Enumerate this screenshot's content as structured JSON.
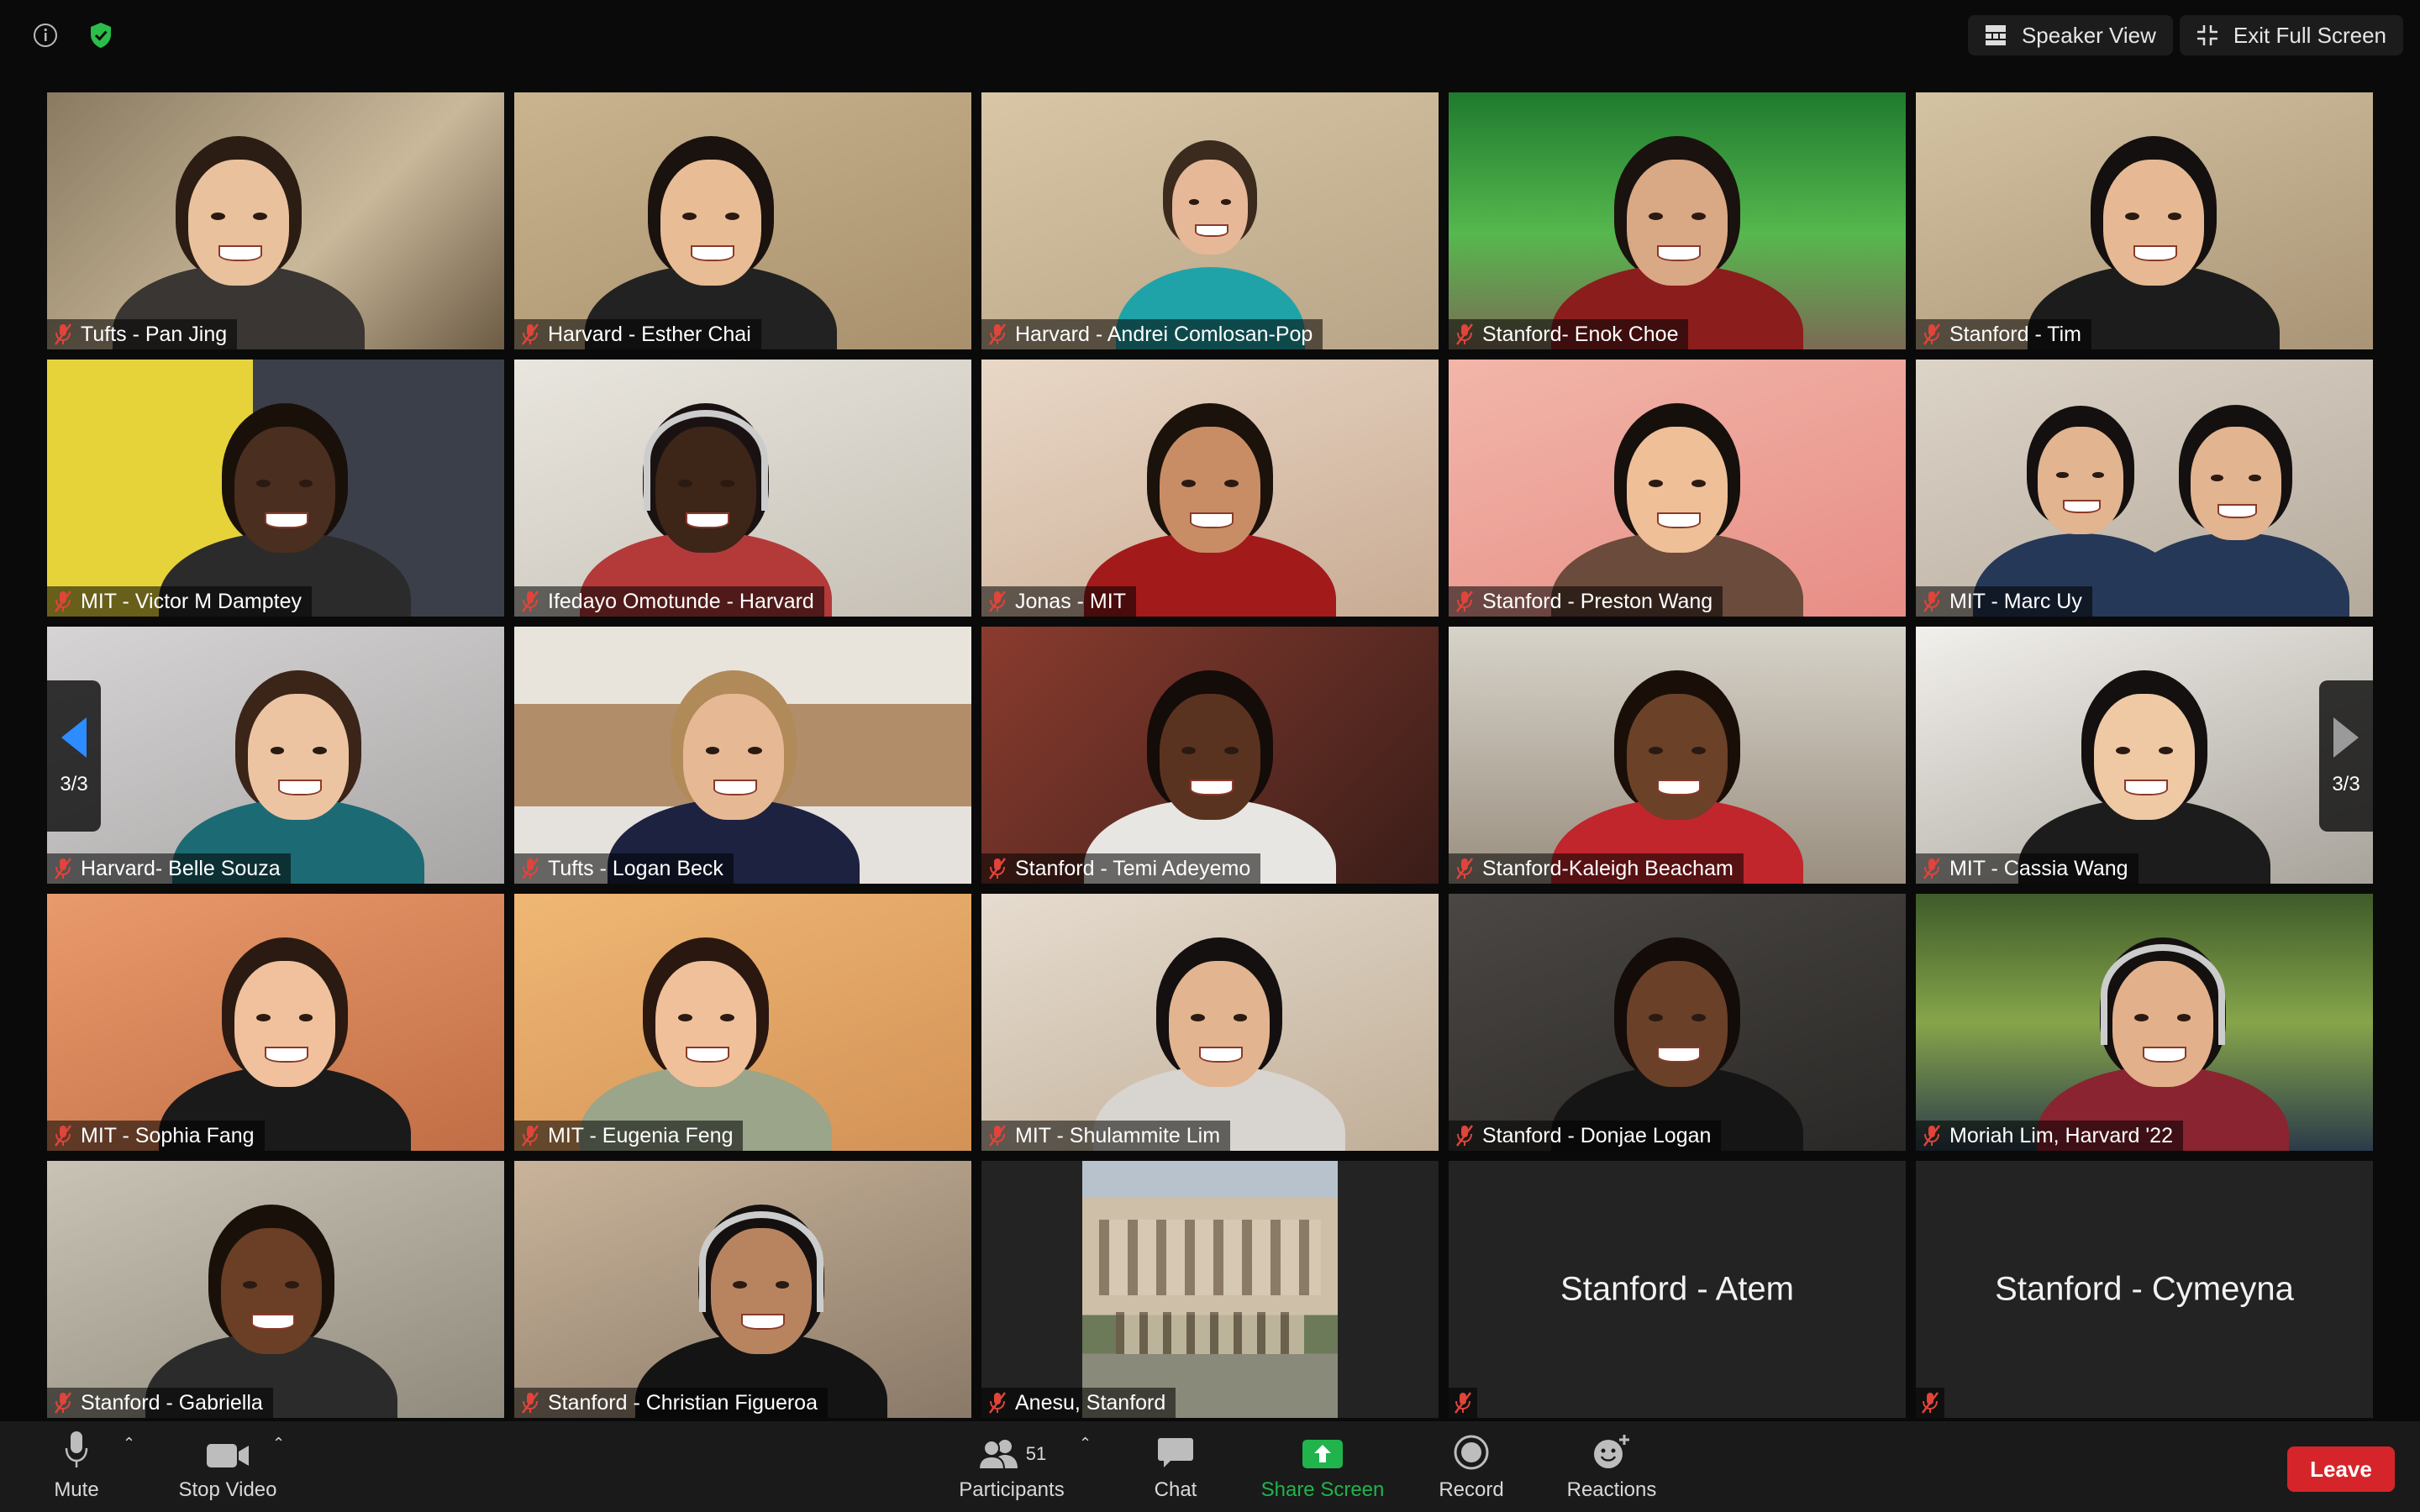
{
  "topbar": {
    "speaker_view_label": "Speaker View",
    "exit_fullscreen_label": "Exit Full Screen"
  },
  "pager": {
    "left_page": "3/3",
    "right_page": "3/3"
  },
  "participants": [
    {
      "name": "Tufts - Pan Jing",
      "muted": true
    },
    {
      "name": "Harvard - Esther Chai",
      "muted": true
    },
    {
      "name": "Harvard - Andrei Comlosan-Pop",
      "muted": true
    },
    {
      "name": "Stanford- Enok Choe",
      "muted": true
    },
    {
      "name": "Stanford - Tim",
      "muted": true
    },
    {
      "name": "MIT - Victor M Damptey",
      "muted": true
    },
    {
      "name": "Ifedayo Omotunde - Harvard",
      "muted": true
    },
    {
      "name": "Jonas - MIT",
      "muted": true
    },
    {
      "name": "Stanford - Preston Wang",
      "muted": true
    },
    {
      "name": "MIT - Marc Uy",
      "muted": true
    },
    {
      "name": "Harvard- Belle Souza",
      "muted": true
    },
    {
      "name": "Tufts - Logan Beck",
      "muted": true
    },
    {
      "name": "Stanford - Temi Adeyemo",
      "muted": true
    },
    {
      "name": "Stanford-Kaleigh Beacham",
      "muted": true
    },
    {
      "name": "MIT - Cassia Wang",
      "muted": true
    },
    {
      "name": "MIT - Sophia Fang",
      "muted": true
    },
    {
      "name": "MIT - Eugenia Feng",
      "muted": true
    },
    {
      "name": "MIT - Shulammite Lim",
      "muted": true
    },
    {
      "name": "Stanford - Donjae Logan",
      "muted": true
    },
    {
      "name": "Moriah Lim, Harvard '22",
      "muted": true
    },
    {
      "name": "Stanford - Gabriella",
      "muted": true
    },
    {
      "name": "Stanford - Christian Figueroa",
      "muted": true
    },
    {
      "name": "Anesu, Stanford",
      "muted": true
    },
    {
      "name": "Stanford - Atem",
      "muted": true
    },
    {
      "name": "Stanford - Cymeyna",
      "muted": true
    }
  ],
  "toolbar": {
    "mute_label": "Mute",
    "stop_video_label": "Stop Video",
    "participants_label": "Participants",
    "participants_count": "51",
    "chat_label": "Chat",
    "share_screen_label": "Share Screen",
    "record_label": "Record",
    "reactions_label": "Reactions",
    "leave_label": "Leave"
  },
  "colors": {
    "accent_blue": "#2d8cff",
    "share_green": "#21b34c",
    "leave_red": "#d6252a",
    "shield_green": "#2bbd4a",
    "mic_off_red": "#e0443a"
  }
}
